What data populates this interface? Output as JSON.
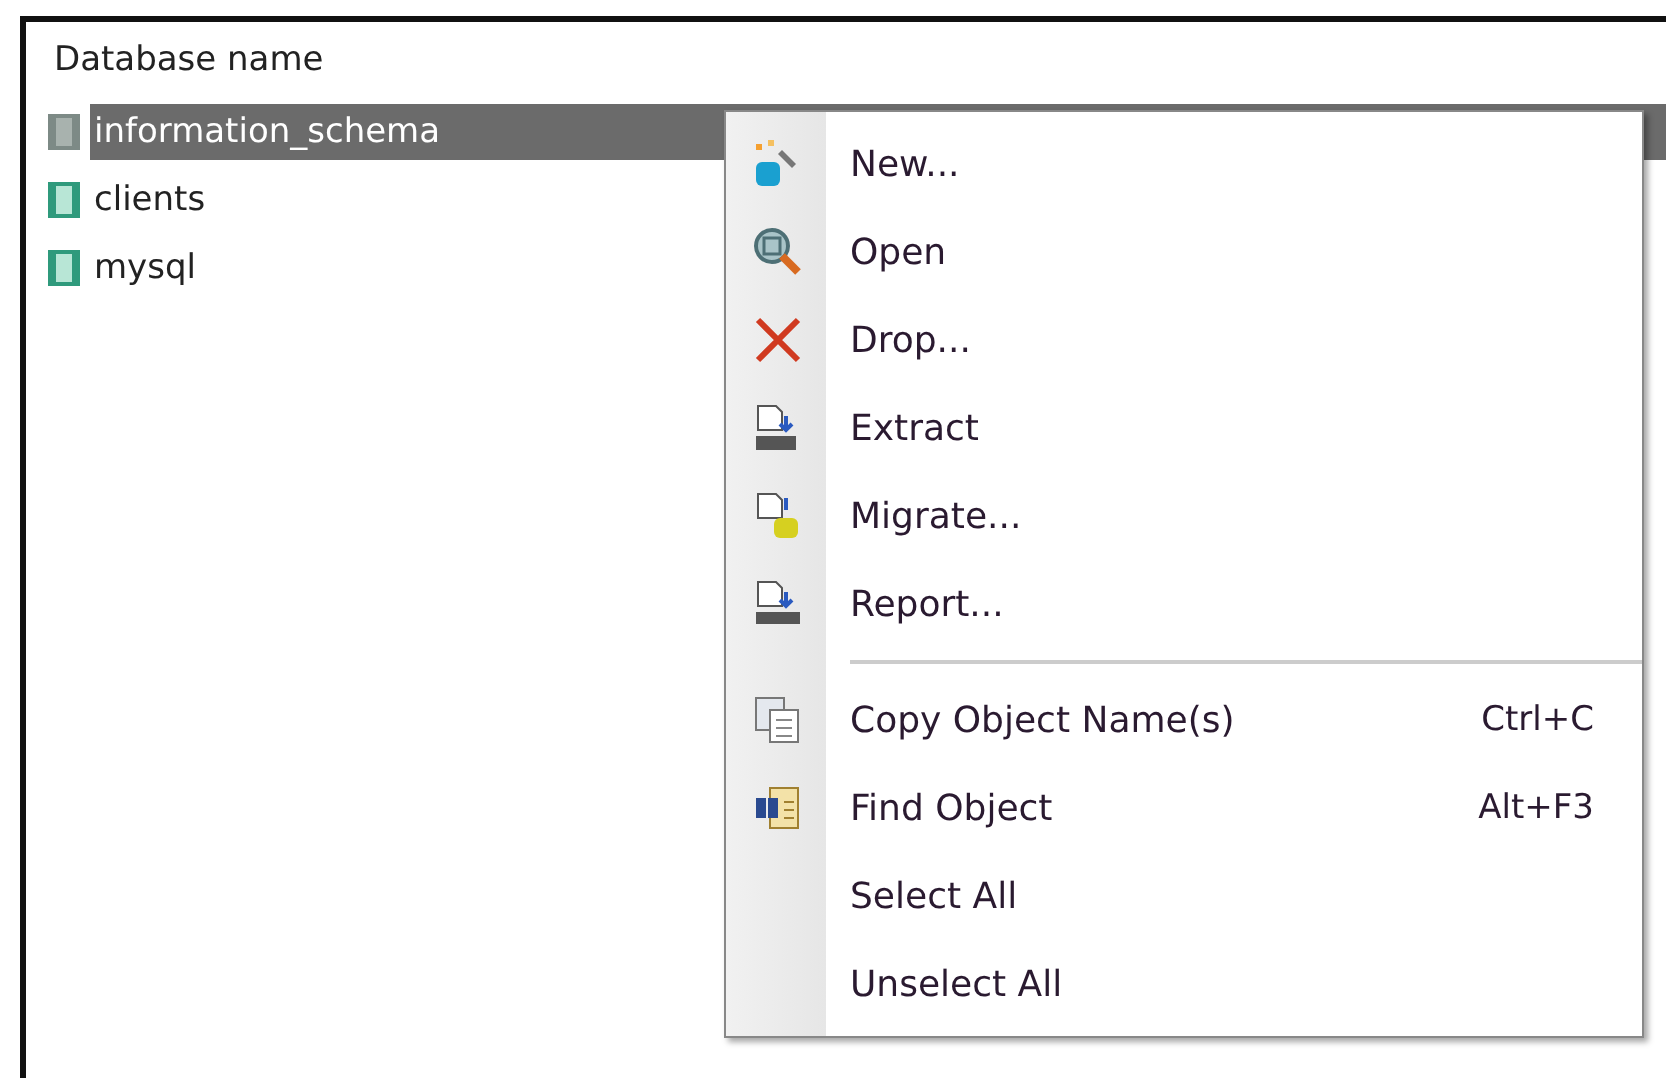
{
  "list": {
    "header": "Database name",
    "rows": [
      {
        "name": "information_schema",
        "selected": true
      },
      {
        "name": "clients",
        "selected": false
      },
      {
        "name": "mysql",
        "selected": false
      }
    ]
  },
  "context_menu": {
    "items": [
      {
        "kind": "command",
        "label": "New..."
      },
      {
        "kind": "command",
        "label": "Open"
      },
      {
        "kind": "command",
        "label": "Drop..."
      },
      {
        "kind": "command",
        "label": "Extract"
      },
      {
        "kind": "command",
        "label": "Migrate..."
      },
      {
        "kind": "command",
        "label": "Report..."
      },
      {
        "kind": "separator"
      },
      {
        "kind": "command",
        "label": "Copy Object Name(s)",
        "shortcut": "Ctrl+C"
      },
      {
        "kind": "command",
        "label": "Find Object",
        "shortcut": "Alt+F3"
      },
      {
        "kind": "command",
        "label": "Select All"
      },
      {
        "kind": "command",
        "label": "Unselect All"
      }
    ]
  }
}
